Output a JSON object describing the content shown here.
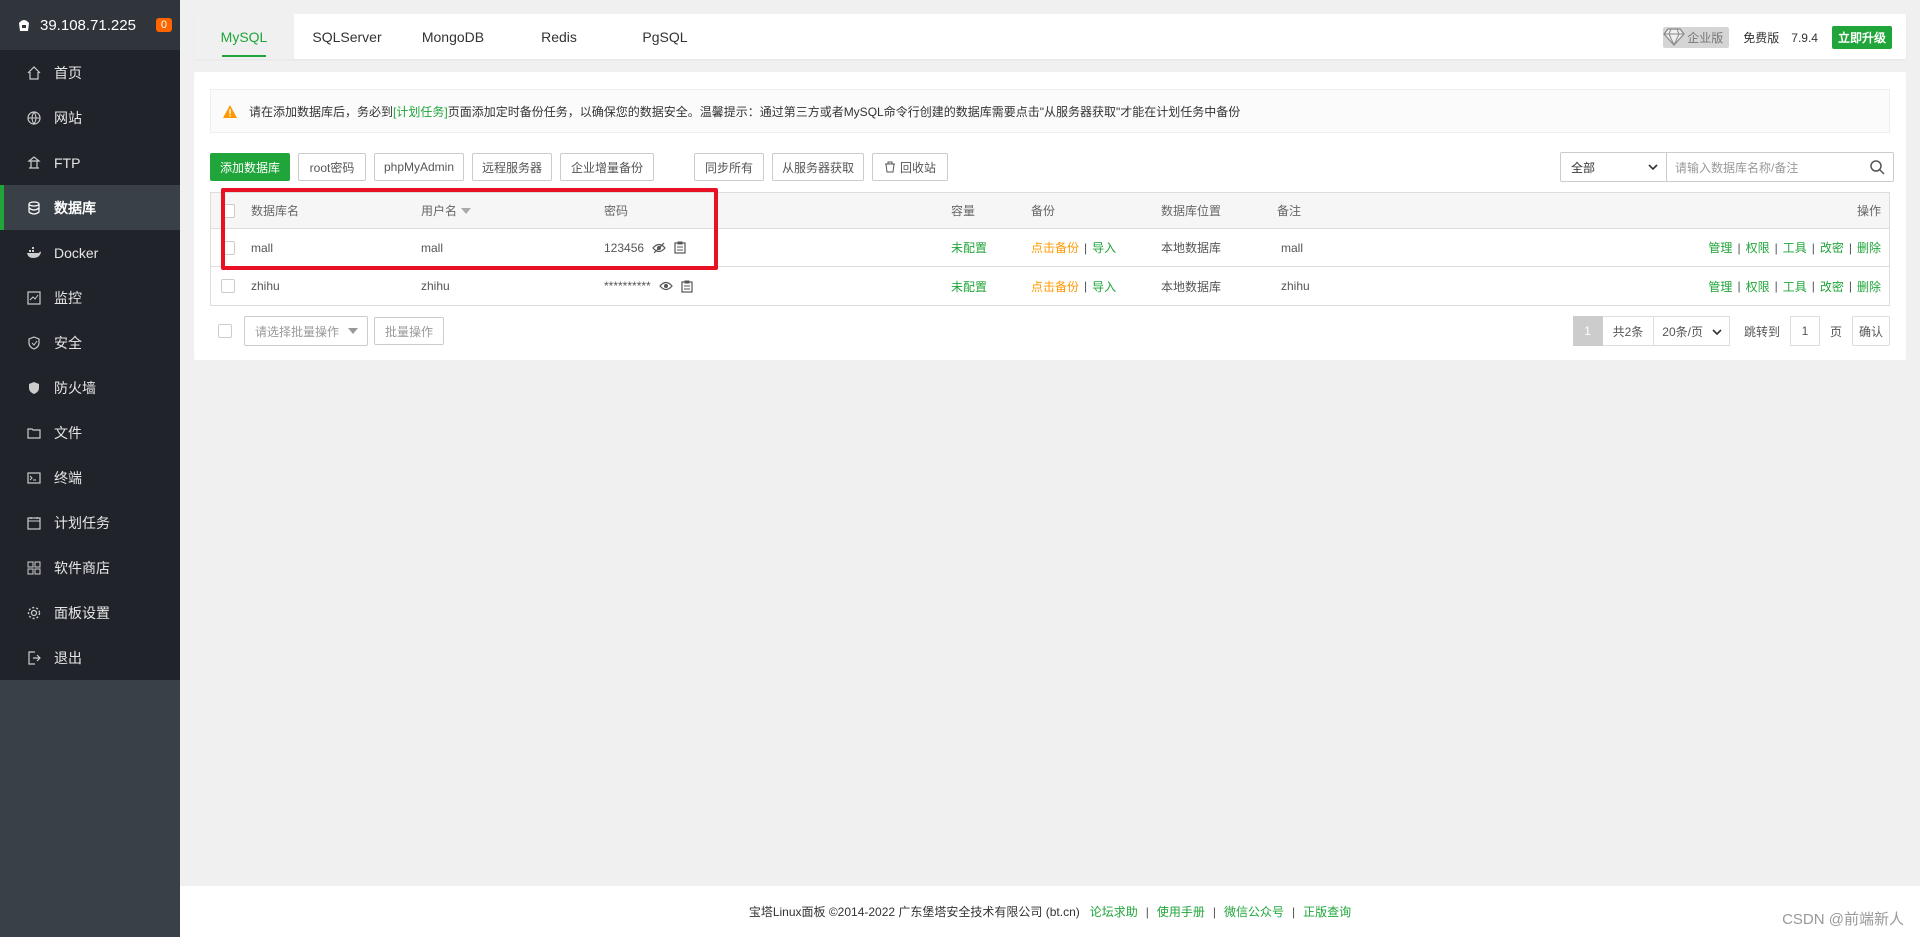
{
  "sidebar": {
    "server_ip": "39.108.71.225",
    "badge": "0",
    "items": [
      {
        "label": "首页",
        "icon": "home-icon"
      },
      {
        "label": "网站",
        "icon": "globe-icon"
      },
      {
        "label": "FTP",
        "icon": "ftp-icon"
      },
      {
        "label": "数据库",
        "icon": "database-icon",
        "active": true
      },
      {
        "label": "Docker",
        "icon": "docker-icon"
      },
      {
        "label": "监控",
        "icon": "monitor-icon"
      },
      {
        "label": "安全",
        "icon": "shield-icon"
      },
      {
        "label": "防火墙",
        "icon": "firewall-icon"
      },
      {
        "label": "文件",
        "icon": "folder-icon"
      },
      {
        "label": "终端",
        "icon": "terminal-icon"
      },
      {
        "label": "计划任务",
        "icon": "calendar-icon"
      },
      {
        "label": "软件商店",
        "icon": "apps-icon"
      },
      {
        "label": "面板设置",
        "icon": "settings-icon"
      },
      {
        "label": "退出",
        "icon": "logout-icon"
      }
    ]
  },
  "tabs": [
    "MySQL",
    "SQLServer",
    "MongoDB",
    "Redis",
    "PgSQL"
  ],
  "version": {
    "enterprise": "企业版",
    "free": "免费版",
    "number": "7.9.4",
    "upgrade": "立即升级"
  },
  "notice": {
    "part1": "请在添加数据库后，务必到",
    "link": "[计划任务]",
    "part2": "页面添加定时备份任务，以确保您的数据安全。温馨提示：通过第三方或者MySQL命令行创建的数据库需要点击\"从服务器获取\"才能在计划任务中备份"
  },
  "toolbar": {
    "add": "添加数据库",
    "root": "root密码",
    "phpmyadmin": "phpMyAdmin",
    "remote": "远程服务器",
    "incremental": "企业增量备份",
    "sync_all": "同步所有",
    "fetch": "从服务器获取",
    "recycle": "回收站",
    "filter": "全部",
    "search_placeholder": "请输入数据库名称/备注"
  },
  "table": {
    "headers": {
      "name": "数据库名",
      "user": "用户名",
      "password": "密码",
      "capacity": "容量",
      "backup": "备份",
      "location": "数据库位置",
      "note": "备注",
      "ops": "操作"
    },
    "rows": [
      {
        "name": "mall",
        "user": "mall",
        "password": "123456",
        "capacity": "未配置",
        "backup": "点击备份",
        "import": "导入",
        "location": "本地数据库",
        "note": "mall"
      },
      {
        "name": "zhihu",
        "user": "zhihu",
        "password": "**********",
        "capacity": "未配置",
        "backup": "点击备份",
        "import": "导入",
        "location": "本地数据库",
        "note": "zhihu"
      }
    ],
    "ops": {
      "manage": "管理",
      "perm": "权限",
      "tools": "工具",
      "change_pwd": "改密",
      "delete": "删除"
    }
  },
  "batch": {
    "select": "请选择批量操作",
    "button": "批量操作"
  },
  "pagination": {
    "current": "1",
    "total": "共2条",
    "size": "20条/页",
    "jump": "跳转到",
    "page": "1",
    "unit": "页",
    "confirm": "确认"
  },
  "footer": {
    "copyright": "宝塔Linux面板 ©2014-2022 广东堡塔安全技术有限公司 (bt.cn)",
    "links": [
      "论坛求助",
      "使用手册",
      "微信公众号",
      "正版查询"
    ]
  },
  "watermark": "CSDN @前端新人",
  "colors": {
    "brand": "#20a53a",
    "highlight_box": "#e81123",
    "warning": "#ff9900"
  }
}
